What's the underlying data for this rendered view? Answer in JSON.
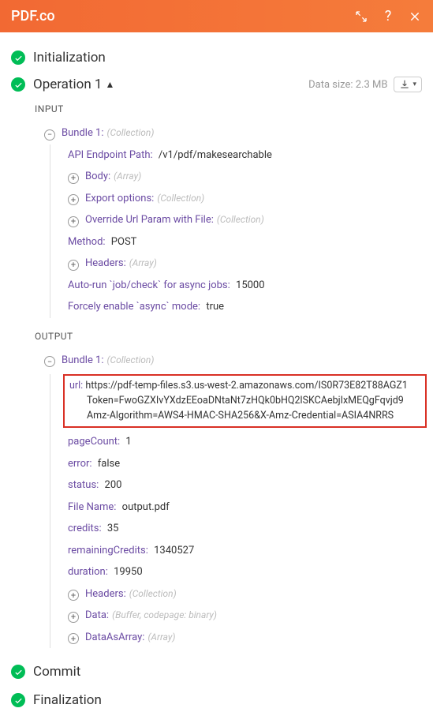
{
  "header": {
    "title": "PDF.co"
  },
  "sections": {
    "initialization": "Initialization",
    "operation": "Operation 1",
    "commit": "Commit",
    "finalization": "Finalization"
  },
  "dataSize": "Data size: 2.3 MB",
  "input": {
    "label": "INPUT",
    "bundle": {
      "label": "Bundle 1:",
      "hint": "(Collection)",
      "apiEndpoint": {
        "label": "API Endpoint Path:",
        "value": "/v1/pdf/makesearchable"
      },
      "body": {
        "label": "Body:",
        "hint": "(Array)"
      },
      "exportOptions": {
        "label": "Export options:",
        "hint": "(Collection)"
      },
      "overrideUrl": {
        "label": "Override Url Param with File:",
        "hint": "(Collection)"
      },
      "method": {
        "label": "Method:",
        "value": "POST"
      },
      "headers": {
        "label": "Headers:",
        "hint": "(Array)"
      },
      "autoRun": {
        "label": "Auto-run `job/check` for async jobs:",
        "value": "15000"
      },
      "forceAsync": {
        "label": "Forcely enable `async` mode:",
        "value": "true"
      }
    }
  },
  "output": {
    "label": "OUTPUT",
    "bundle": {
      "label": "Bundle 1:",
      "hint": "(Collection)",
      "url": {
        "label": "url:",
        "line1": "https://pdf-temp-files.s3.us-west-2.amazonaws.com/IS0R73E82T88AGZ1",
        "line2": "Token=FwoGZXIvYXdzEEoaDNtaNt7zHQk0bHQ2lSKCAebjIxMEQgFqvjd9",
        "line3": "Amz-Algorithm=AWS4-HMAC-SHA256&X-Amz-Credential=ASIA4NRRS"
      },
      "pageCount": {
        "label": "pageCount:",
        "value": "1"
      },
      "error": {
        "label": "error:",
        "value": "false"
      },
      "status": {
        "label": "status:",
        "value": "200"
      },
      "fileName": {
        "label": "File Name:",
        "value": "output.pdf"
      },
      "credits": {
        "label": "credits:",
        "value": "35"
      },
      "remainingCredits": {
        "label": "remainingCredits:",
        "value": "1340527"
      },
      "duration": {
        "label": "duration:",
        "value": "19950"
      },
      "headers": {
        "label": "Headers:",
        "hint": "(Collection)"
      },
      "data": {
        "label": "Data:",
        "hint": "(Buffer, codepage: binary)"
      },
      "dataAsArray": {
        "label": "DataAsArray:",
        "hint": "(Array)"
      }
    }
  }
}
